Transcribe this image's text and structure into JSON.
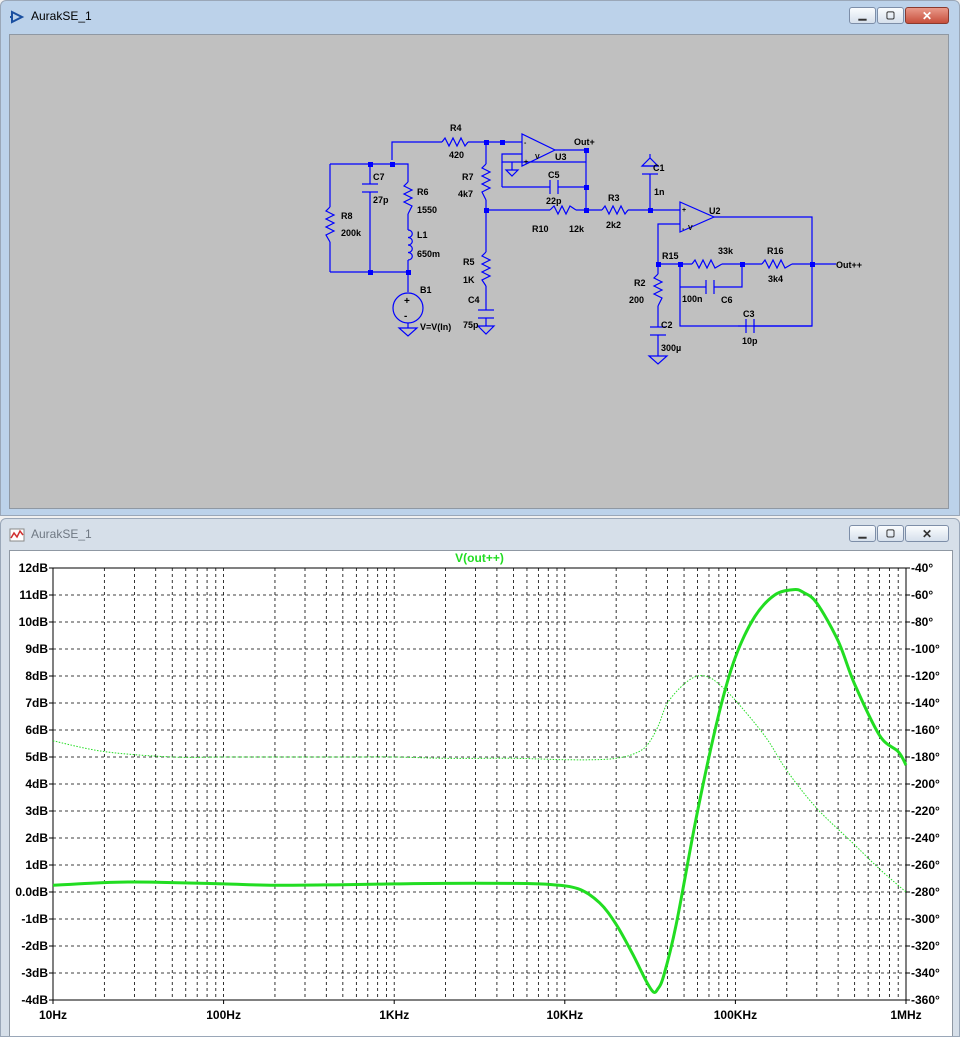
{
  "schematic_window": {
    "title": "AurakSE_1",
    "colors": {
      "background": "#c0c0c0",
      "wire": "#0000ff",
      "label": "#000000"
    },
    "components": {
      "R4": {
        "name": "R4",
        "value": "420"
      },
      "R8": {
        "name": "R8",
        "value": "200k"
      },
      "C7": {
        "name": "C7",
        "value": "27p"
      },
      "R6": {
        "name": "R6",
        "value": "1550"
      },
      "L1": {
        "name": "L1",
        "value": "650m"
      },
      "B1": {
        "name": "B1",
        "value": "V=V(In)"
      },
      "R7": {
        "name": "R7",
        "value": "4k7"
      },
      "R5": {
        "name": "R5",
        "value": "1K"
      },
      "C4": {
        "name": "C4",
        "value": "75p"
      },
      "U3": {
        "name": "U3"
      },
      "C5": {
        "name": "C5",
        "value": "22p"
      },
      "R10": {
        "name": "R10",
        "value": "12k"
      },
      "R3": {
        "name": "R3",
        "value": "2k2"
      },
      "C1": {
        "name": "C1",
        "value": "1n"
      },
      "U2": {
        "name": "U2"
      },
      "R15": {
        "name": "R15",
        "value": "33k"
      },
      "R16": {
        "name": "R16",
        "value": "3k4"
      },
      "R2": {
        "name": "R2",
        "value": "200"
      },
      "C6": {
        "name": "C6",
        "value": "100n"
      },
      "C2": {
        "name": "C2",
        "value": "300µ"
      },
      "C3": {
        "name": "C3",
        "value": "10p"
      }
    },
    "net_labels": {
      "out_plus": "Out+",
      "out_plusplus": "Out++"
    }
  },
  "plot_window": {
    "title": "AurakSE_1",
    "trace_label": "V(out++)",
    "colors": {
      "background": "#ffffff",
      "trace": "#22dd22",
      "grid": "#000000"
    }
  },
  "chart_data": {
    "type": "line",
    "title": "V(out++)",
    "x_scale": "log",
    "xlim": [
      10,
      1000000
    ],
    "x_ticks": [
      "10Hz",
      "100Hz",
      "1KHz",
      "10KHz",
      "100KHz",
      "1MHz"
    ],
    "y_left": {
      "unit": "dB",
      "range": [
        -4,
        12
      ],
      "ticks": [
        "12dB",
        "11dB",
        "10dB",
        "9dB",
        "8dB",
        "7dB",
        "6dB",
        "5dB",
        "4dB",
        "3dB",
        "2dB",
        "1dB",
        "0.0dB",
        "-1dB",
        "-2dB",
        "-3dB",
        "-4dB"
      ]
    },
    "y_right": {
      "unit": "deg",
      "range": [
        -360,
        -40
      ],
      "ticks": [
        "-40°",
        "-60°",
        "-80°",
        "-100°",
        "-120°",
        "-140°",
        "-160°",
        "-180°",
        "-200°",
        "-220°",
        "-240°",
        "-260°",
        "-280°",
        "-300°",
        "-320°",
        "-340°",
        "-360°"
      ]
    },
    "grid": true,
    "series": [
      {
        "name": "V(out++)",
        "kind": "magnitude",
        "axis": "left",
        "style": "solid",
        "x": [
          10,
          20,
          30,
          50,
          100,
          200,
          500,
          1000,
          2000,
          5000,
          8000,
          12000,
          16000,
          20000,
          25000,
          30000,
          33000,
          35000,
          38000,
          45000,
          60000,
          80000,
          100000,
          130000,
          170000,
          220000,
          250000,
          300000,
          400000,
          500000,
          700000,
          900000,
          1000000
        ],
        "y": [
          0.25,
          0.35,
          0.37,
          0.35,
          0.3,
          0.25,
          0.27,
          0.3,
          0.32,
          0.32,
          0.28,
          0.12,
          -0.4,
          -1.2,
          -2.3,
          -3.3,
          -3.7,
          -3.6,
          -3.1,
          -1.2,
          3.0,
          6.6,
          8.7,
          10.2,
          11.0,
          11.2,
          11.1,
          10.7,
          9.3,
          7.7,
          5.8,
          5.2,
          4.7
        ]
      },
      {
        "name": "V(out++)",
        "kind": "phase",
        "axis": "right",
        "style": "dashed",
        "x": [
          10,
          20,
          50,
          100,
          200,
          500,
          1000,
          2000,
          5000,
          10000,
          15000,
          20000,
          25000,
          30000,
          35000,
          40000,
          50000,
          60000,
          70000,
          80000,
          100000,
          150000,
          200000,
          300000,
          500000,
          700000,
          1000000
        ],
        "y": [
          -168,
          -176,
          -180,
          -180,
          -180,
          -180,
          -180,
          -181,
          -181,
          -182,
          -182,
          -181,
          -178,
          -172,
          -158,
          -140,
          -126,
          -120,
          -121,
          -126,
          -138,
          -165,
          -190,
          -218,
          -245,
          -263,
          -280
        ]
      }
    ]
  }
}
